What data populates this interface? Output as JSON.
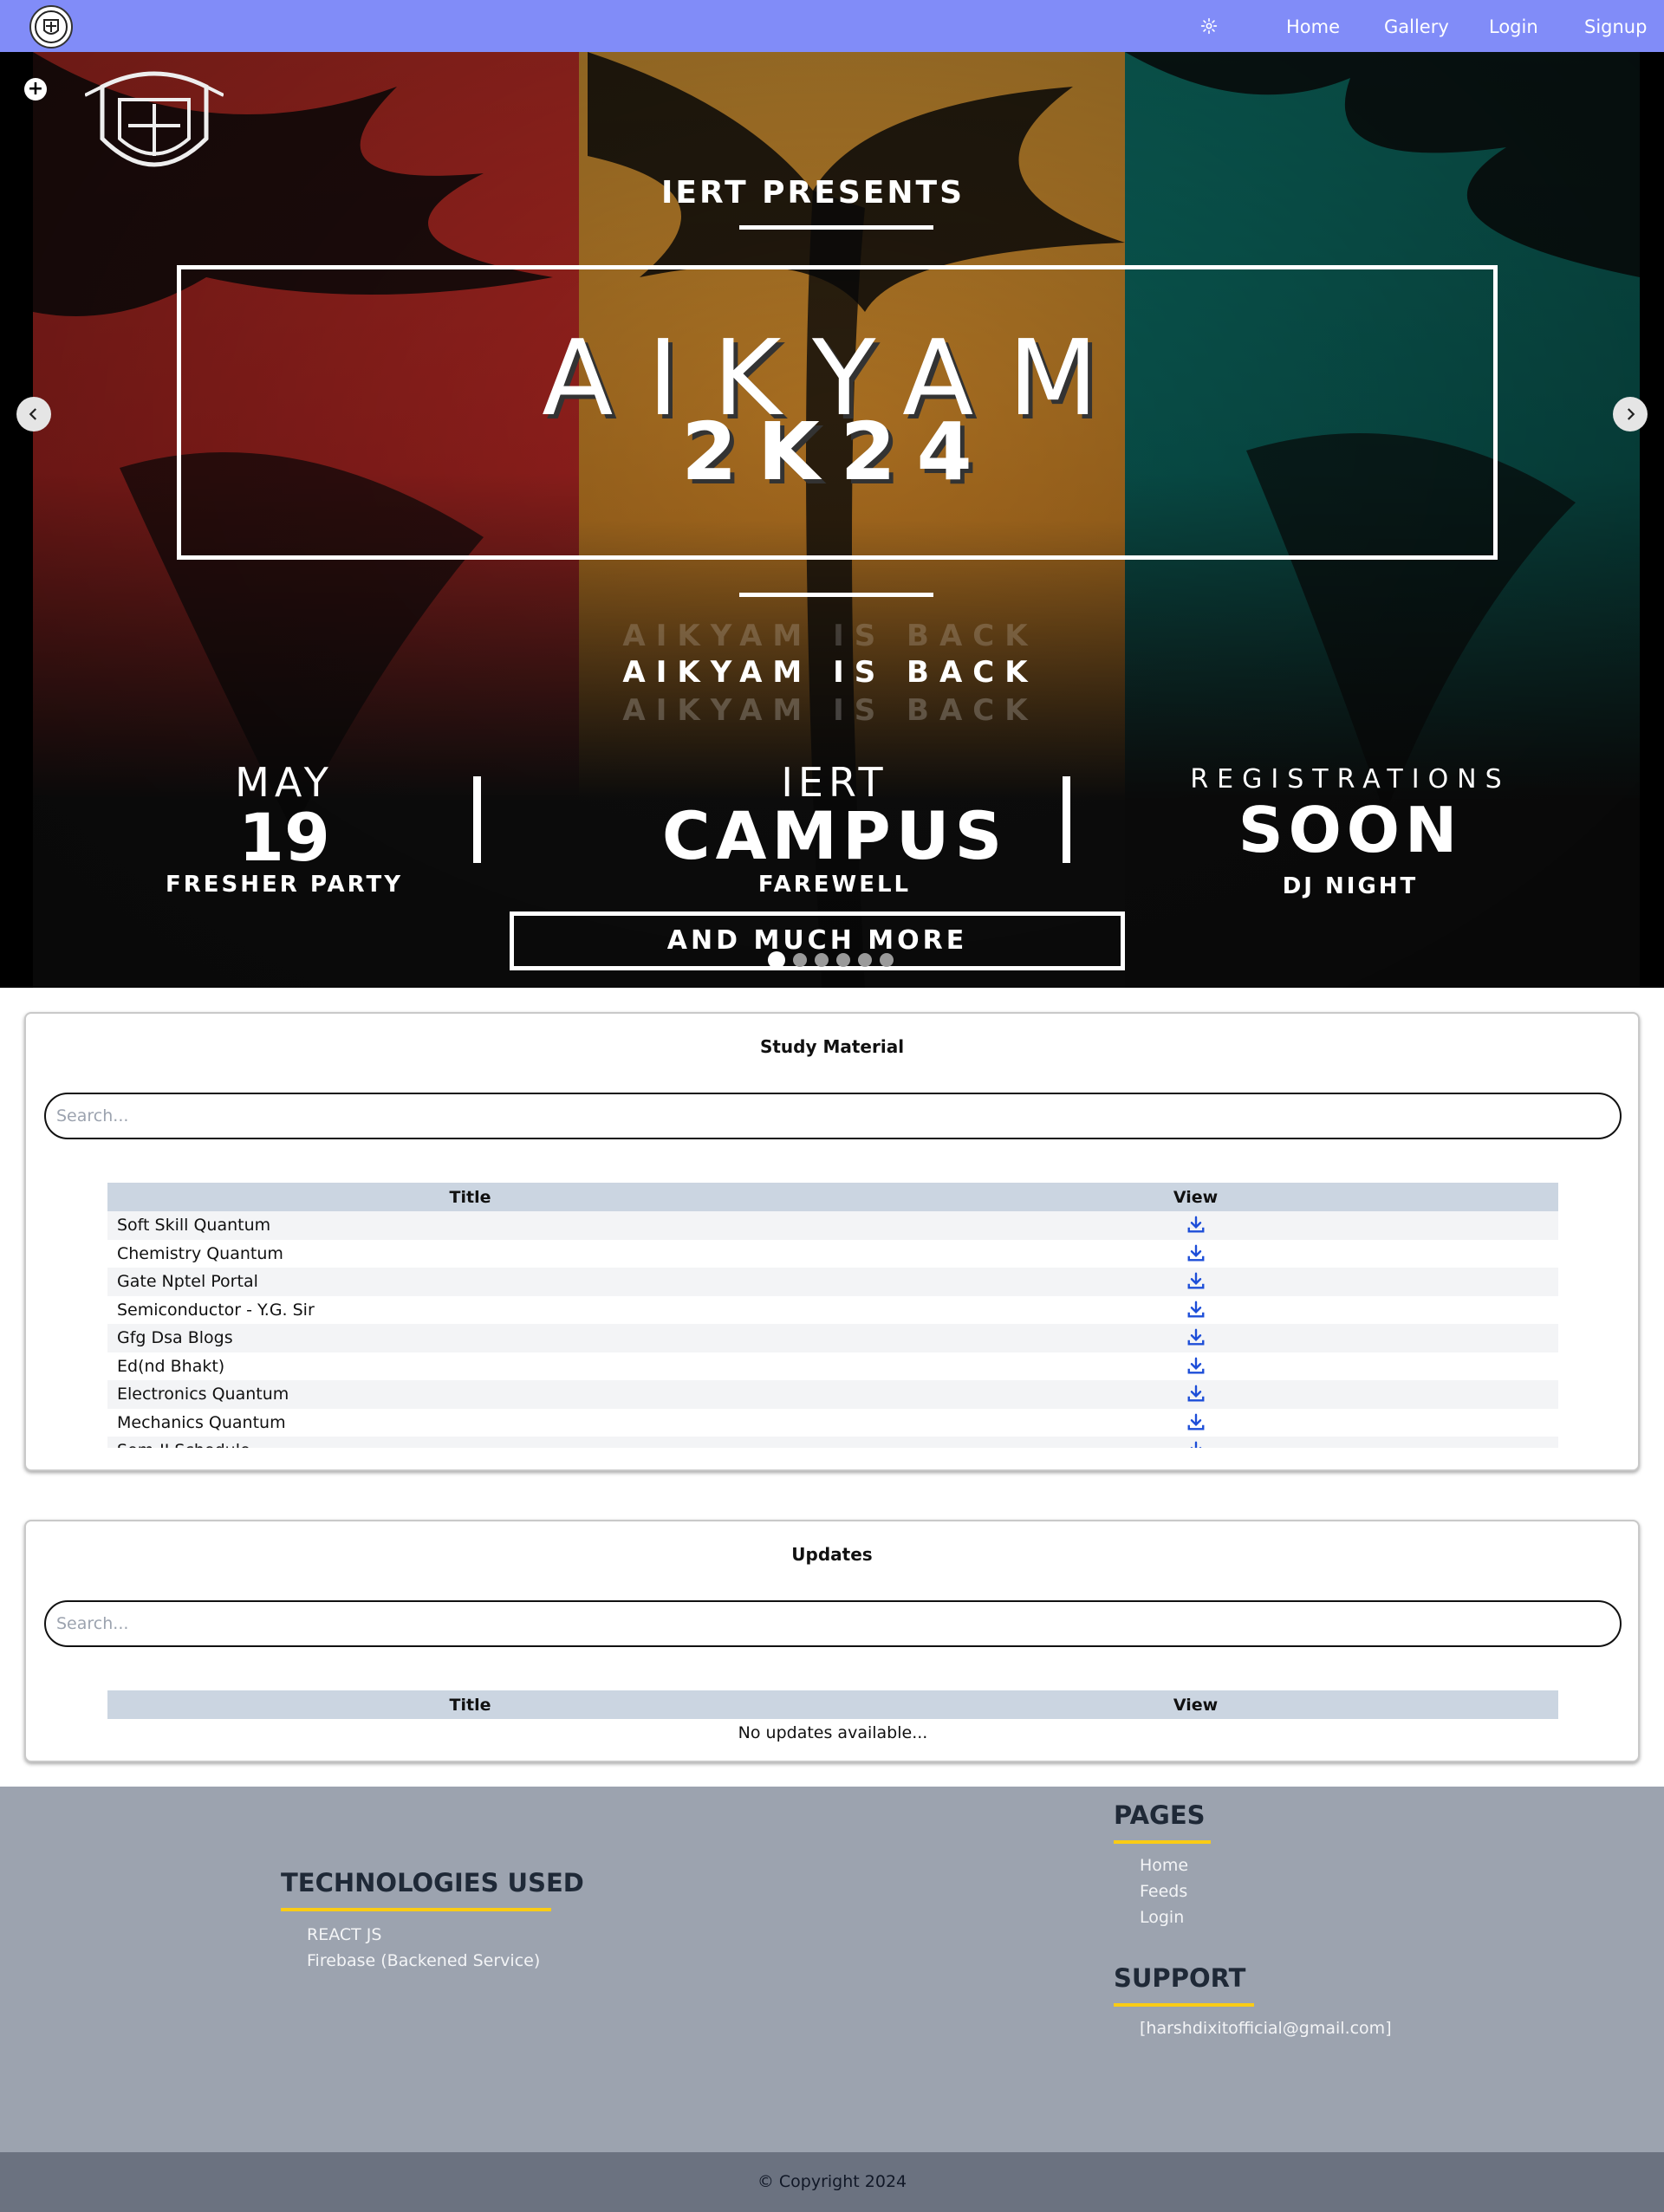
{
  "navbar": {
    "logo_alt": "IERT logo",
    "settings_icon": "gear-icon",
    "links": {
      "home": "Home",
      "gallery": "Gallery",
      "login": "Login",
      "signup": "Signup"
    },
    "color": "#818cf8"
  },
  "carousel": {
    "slide": {
      "presents": "IERT PRESENTS",
      "title_line1": "AIKYAM",
      "title_line2": "2K24",
      "tagline": "AIKYAM IS BACK",
      "col1_top": "MAY",
      "col1_big": "19",
      "col1_bottom": "FRESHER PARTY",
      "col2_top": "IERT",
      "col2_big": "CAMPUS",
      "col2_bottom": "FAREWELL",
      "col3_top": "REGISTRATIONS",
      "col3_big": "SOON",
      "col3_bottom": "DJ NIGHT",
      "footer_box": "AND MUCH MORE"
    },
    "prev_icon": "chevron-left-icon",
    "next_icon": "chevron-right-icon",
    "add_icon": "plus-circle-icon",
    "slide_count": 6,
    "active_slide": 1
  },
  "study_material": {
    "title": "Study Material",
    "search_placeholder": "Search...",
    "columns": {
      "title": "Title",
      "view": "View"
    },
    "rows": [
      {
        "title": "Soft Skill Quantum",
        "icon": "download-icon"
      },
      {
        "title": "Chemistry Quantum",
        "icon": "download-icon"
      },
      {
        "title": "Gate Nptel Portal",
        "icon": "download-icon"
      },
      {
        "title": "Semiconductor - Y.G. Sir",
        "icon": "download-icon"
      },
      {
        "title": "Gfg Dsa Blogs",
        "icon": "download-icon"
      },
      {
        "title": "Ed(nd Bhakt)",
        "icon": "download-icon"
      },
      {
        "title": "Electronics Quantum",
        "icon": "download-icon"
      },
      {
        "title": "Mechanics Quantum",
        "icon": "download-icon"
      },
      {
        "title": "Sem-II Schedule",
        "icon": "download-icon"
      }
    ],
    "header_color": "#cbd5e1",
    "icon_color": "#1d4ed8"
  },
  "updates": {
    "title": "Updates",
    "search_placeholder": "Search...",
    "columns": {
      "title": "Title",
      "view": "View"
    },
    "empty_message": "No updates available..."
  },
  "footer": {
    "technologies": {
      "heading": "TECHNOLOGIES USED",
      "items": [
        "REACT JS",
        "Firebase (Backened Service)"
      ]
    },
    "pages": {
      "heading": "PAGES",
      "items": [
        "Home",
        "Feeds",
        "Login"
      ]
    },
    "support": {
      "heading": "SUPPORT",
      "items": [
        "[harshdixitofficial@gmail.com]"
      ]
    },
    "accent_color": "#facc15",
    "copyright": "© Copyright 2024"
  }
}
